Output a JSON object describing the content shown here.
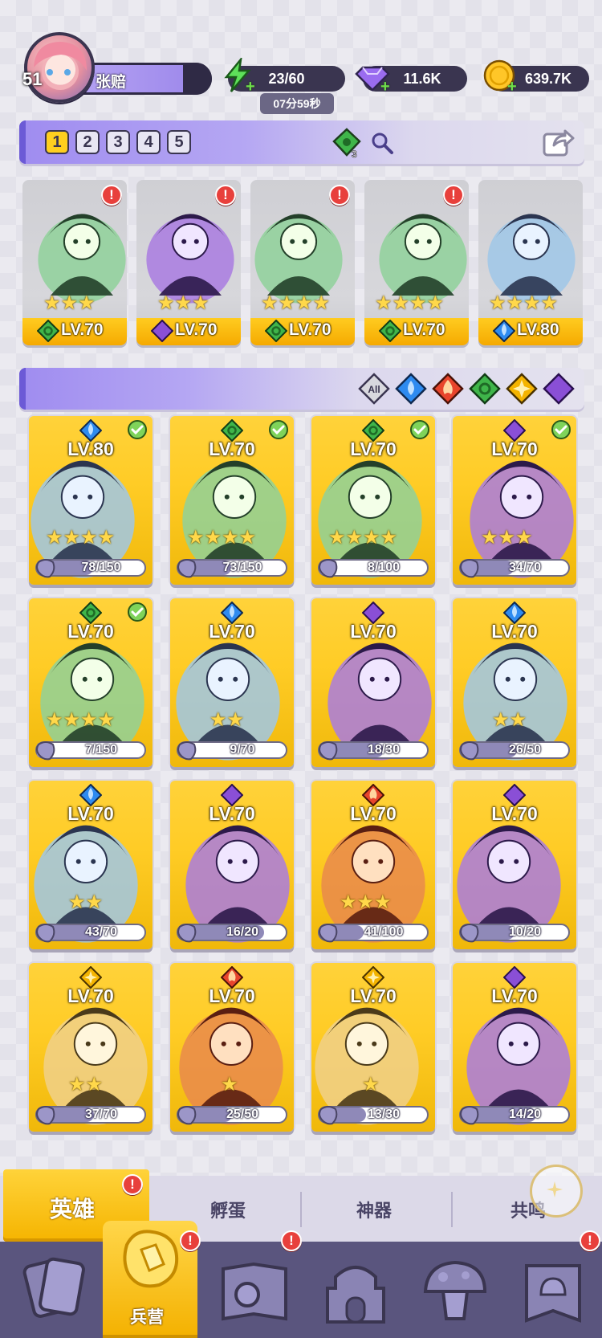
{
  "player": {
    "level": "51",
    "name": "张赔"
  },
  "resources": {
    "energy": "23/60",
    "energy_timer": "07分59秒",
    "gems": "11.6K",
    "gold": "639.7K"
  },
  "team": {
    "tabs": [
      "1",
      "2",
      "3",
      "4",
      "5"
    ],
    "active_tab": "1",
    "power_badge": "3",
    "slots": [
      {
        "level": "LV.70",
        "element": "wind",
        "stars": 3,
        "alert": true
      },
      {
        "level": "LV.70",
        "element": "dark",
        "stars": 3,
        "alert": true
      },
      {
        "level": "LV.70",
        "element": "wind",
        "stars": 4,
        "alert": true
      },
      {
        "level": "LV.70",
        "element": "wind",
        "stars": 4,
        "alert": true
      },
      {
        "level": "LV.80",
        "element": "water",
        "stars": 4,
        "alert": false
      }
    ]
  },
  "filters": {
    "all_label": "All",
    "elements": [
      "water",
      "fire",
      "wind",
      "light",
      "dark"
    ]
  },
  "heroes": [
    {
      "level": "LV.80",
      "element": "water",
      "stars": 4,
      "shards": "78/150",
      "progress": 0.52,
      "check": true
    },
    {
      "level": "LV.70",
      "element": "wind",
      "stars": 4,
      "shards": "73/150",
      "progress": 0.49,
      "check": true
    },
    {
      "level": "LV.70",
      "element": "wind",
      "stars": 4,
      "shards": "8/100",
      "progress": 0.08,
      "check": true
    },
    {
      "level": "LV.70",
      "element": "dark",
      "stars": 3,
      "shards": "34/70",
      "progress": 0.49,
      "check": true
    },
    {
      "level": "LV.70",
      "element": "wind",
      "stars": 4,
      "shards": "7/150",
      "progress": 0.05,
      "check": true
    },
    {
      "level": "LV.70",
      "element": "water",
      "stars": 2,
      "shards": "9/70",
      "progress": 0.13,
      "check": false
    },
    {
      "level": "LV.70",
      "element": "dark",
      "stars": 0,
      "shards": "18/30",
      "progress": 0.6,
      "check": false
    },
    {
      "level": "LV.70",
      "element": "water",
      "stars": 2,
      "shards": "26/50",
      "progress": 0.52,
      "check": false
    },
    {
      "level": "LV.70",
      "element": "water",
      "stars": 2,
      "shards": "43/70",
      "progress": 0.61,
      "check": false
    },
    {
      "level": "LV.70",
      "element": "dark",
      "stars": 0,
      "shards": "16/20",
      "progress": 0.8,
      "check": false
    },
    {
      "level": "LV.70",
      "element": "fire",
      "stars": 3,
      "shards": "41/100",
      "progress": 0.41,
      "check": false
    },
    {
      "level": "LV.70",
      "element": "dark",
      "stars": 0,
      "shards": "10/20",
      "progress": 0.5,
      "check": false
    },
    {
      "level": "LV.70",
      "element": "light",
      "stars": 2,
      "shards": "37/70",
      "progress": 0.53,
      "check": false
    },
    {
      "level": "LV.70",
      "element": "fire",
      "stars": 1,
      "shards": "25/50",
      "progress": 0.5,
      "check": false
    },
    {
      "level": "LV.70",
      "element": "light",
      "stars": 1,
      "shards": "13/30",
      "progress": 0.43,
      "check": false
    },
    {
      "level": "LV.70",
      "element": "dark",
      "stars": 0,
      "shards": "14/20",
      "progress": 0.7,
      "check": false
    }
  ],
  "subtabs": [
    "英雄",
    "孵蛋",
    "神器",
    "共鸣"
  ],
  "bottom_nav": {
    "active_label": "兵营"
  },
  "colors": {
    "accent": "#9b86ea",
    "gold": "#ffcc20",
    "nav": "#5a557e",
    "alert": "#e8403c",
    "water": "#2e8bf0",
    "fire": "#e8452c",
    "wind": "#3fb54a",
    "light": "#f4b400",
    "dark": "#8a4fd6"
  }
}
